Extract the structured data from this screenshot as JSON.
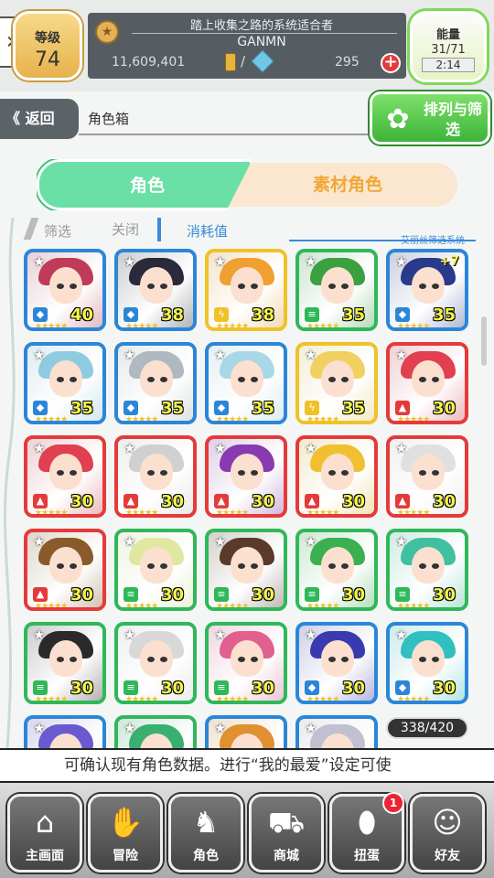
{
  "header": {
    "level_label": "等级",
    "level_value": "74",
    "player_title": "踏上收集之路的系统适合者",
    "player_name": "GANMN",
    "money": "11,609,401",
    "slash": "/",
    "gems": "295",
    "energy_label": "能量",
    "energy_value": "31/71",
    "energy_timer": "2:14"
  },
  "nav_back": {
    "label": "返回"
  },
  "page_title": "角色箱",
  "sort_button": {
    "label": "排列与筛选"
  },
  "tabs": [
    {
      "label": "角色",
      "active": true
    },
    {
      "label": "素材角色",
      "active": false
    }
  ],
  "filter": {
    "filter_label": "筛选",
    "close_label": "关闭",
    "cost_label": "消耗值",
    "system_label": "艾丽丝筛选系统"
  },
  "cards": [
    {
      "value": "40",
      "element": "water",
      "frame": "blue",
      "plus": ""
    },
    {
      "value": "38",
      "element": "water",
      "frame": "blue",
      "plus": ""
    },
    {
      "value": "38",
      "element": "thunder",
      "frame": "yellow",
      "plus": ""
    },
    {
      "value": "35",
      "element": "wind",
      "frame": "green",
      "plus": ""
    },
    {
      "value": "35",
      "element": "water",
      "frame": "blue",
      "plus": "+7"
    },
    {
      "value": "35",
      "element": "water",
      "frame": "blue",
      "plus": ""
    },
    {
      "value": "35",
      "element": "water",
      "frame": "blue",
      "plus": ""
    },
    {
      "value": "35",
      "element": "water",
      "frame": "blue",
      "plus": ""
    },
    {
      "value": "35",
      "element": "thunder",
      "frame": "yellow",
      "plus": ""
    },
    {
      "value": "30",
      "element": "fire",
      "frame": "red",
      "plus": ""
    },
    {
      "value": "30",
      "element": "fire",
      "frame": "red",
      "plus": ""
    },
    {
      "value": "30",
      "element": "fire",
      "frame": "red",
      "plus": ""
    },
    {
      "value": "30",
      "element": "fire",
      "frame": "red",
      "plus": ""
    },
    {
      "value": "30",
      "element": "fire",
      "frame": "red",
      "plus": ""
    },
    {
      "value": "30",
      "element": "fire",
      "frame": "red",
      "plus": ""
    },
    {
      "value": "30",
      "element": "fire",
      "frame": "red",
      "plus": ""
    },
    {
      "value": "30",
      "element": "wind",
      "frame": "green",
      "plus": ""
    },
    {
      "value": "30",
      "element": "wind",
      "frame": "green",
      "plus": ""
    },
    {
      "value": "30",
      "element": "wind",
      "frame": "green",
      "plus": ""
    },
    {
      "value": "30",
      "element": "wind",
      "frame": "green",
      "plus": ""
    },
    {
      "value": "30",
      "element": "wind",
      "frame": "green",
      "plus": ""
    },
    {
      "value": "30",
      "element": "wind",
      "frame": "green",
      "plus": ""
    },
    {
      "value": "30",
      "element": "wind",
      "frame": "green",
      "plus": ""
    },
    {
      "value": "30",
      "element": "water",
      "frame": "blue",
      "plus": ""
    },
    {
      "value": "30",
      "element": "water",
      "frame": "blue",
      "plus": ""
    },
    {
      "value": "",
      "element": "",
      "frame": "blue",
      "plus": ""
    },
    {
      "value": "",
      "element": "",
      "frame": "green",
      "plus": ""
    },
    {
      "value": "",
      "element": "",
      "frame": "blue",
      "plus": ""
    },
    {
      "value": "",
      "element": "",
      "frame": "blue",
      "plus": ""
    }
  ],
  "card_count": "338/420",
  "ticker": "可确认现有角色数据。进行“我的最爱”设定可使",
  "bottom_nav": [
    {
      "label": "主画面",
      "icon": "home-icon"
    },
    {
      "label": "冒险",
      "icon": "handshake-icon"
    },
    {
      "label": "角色",
      "icon": "character-icon"
    },
    {
      "label": "商城",
      "icon": "cart-icon"
    },
    {
      "label": "扭蛋",
      "icon": "egg-icon"
    },
    {
      "label": "好友",
      "icon": "friends-icon"
    }
  ],
  "gacha_badge": "1",
  "colors": {
    "frame_blue": "#2b86d9",
    "frame_red": "#e53a3a",
    "frame_green": "#2fb85a",
    "frame_yellow": "#f0c22a",
    "tab_active": "#6adfa6",
    "tab_inactive_text": "#f0a838",
    "accent": "#3a8ad8"
  }
}
